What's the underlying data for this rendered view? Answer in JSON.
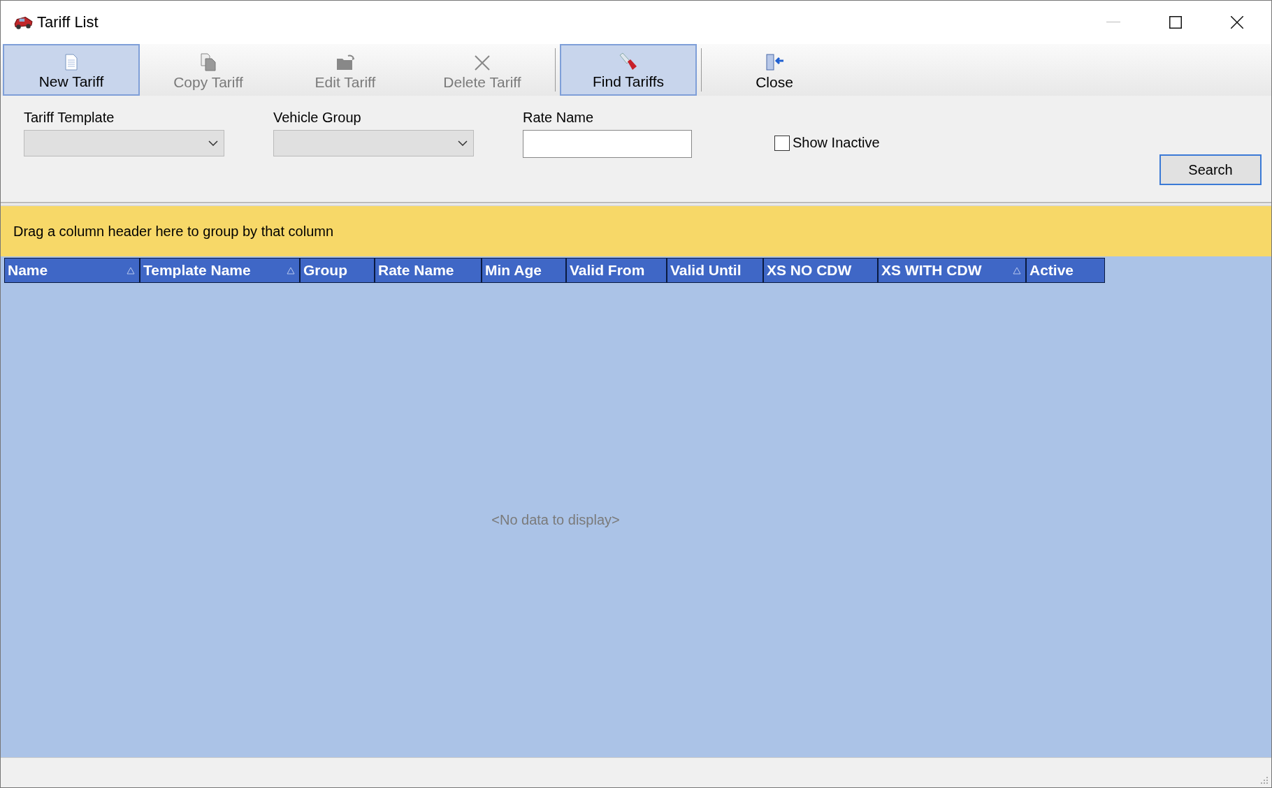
{
  "window": {
    "title": "Tariff List"
  },
  "toolbar": [
    {
      "kind": "new",
      "label": "New Tariff",
      "highlighted": true,
      "disabled": false,
      "separator_after": false
    },
    {
      "kind": "copy",
      "label": "Copy Tariff",
      "highlighted": false,
      "disabled": true,
      "separator_after": false
    },
    {
      "kind": "edit",
      "label": "Edit Tariff",
      "highlighted": false,
      "disabled": true,
      "separator_after": false
    },
    {
      "kind": "delete",
      "label": "Delete Tariff",
      "highlighted": false,
      "disabled": true,
      "separator_after": true
    },
    {
      "kind": "find",
      "label": "Find Tariffs",
      "highlighted": true,
      "disabled": false,
      "separator_after": true
    },
    {
      "kind": "close",
      "label": "Close",
      "highlighted": false,
      "disabled": false,
      "separator_after": false
    }
  ],
  "filters": [
    {
      "kind": "dropdown",
      "label": "Tariff Template"
    },
    {
      "kind": "dropdown",
      "label": "Vehicle Group"
    },
    {
      "kind": "text",
      "label": "Rate Name"
    }
  ],
  "show_inactive": {
    "label": "Show Inactive",
    "checked": false
  },
  "search_button": "Search",
  "group_panel": "Drag a column header here to group by that column",
  "table": {
    "columns": [
      {
        "label": "Name",
        "sort_indicator": true
      },
      {
        "label": "Template Name",
        "sort_indicator": true
      },
      {
        "label": "Group",
        "sort_indicator": false
      },
      {
        "label": "Rate Name",
        "sort_indicator": false
      },
      {
        "label": "Min Age",
        "sort_indicator": false
      },
      {
        "label": "Valid From",
        "sort_indicator": false
      },
      {
        "label": "Valid Until",
        "sort_indicator": false
      },
      {
        "label": "XS NO CDW",
        "sort_indicator": false
      },
      {
        "label": "XS WITH CDW",
        "sort_indicator": true
      },
      {
        "label": "Active",
        "sort_indicator": false
      }
    ],
    "empty_text": "<No data to display>"
  }
}
